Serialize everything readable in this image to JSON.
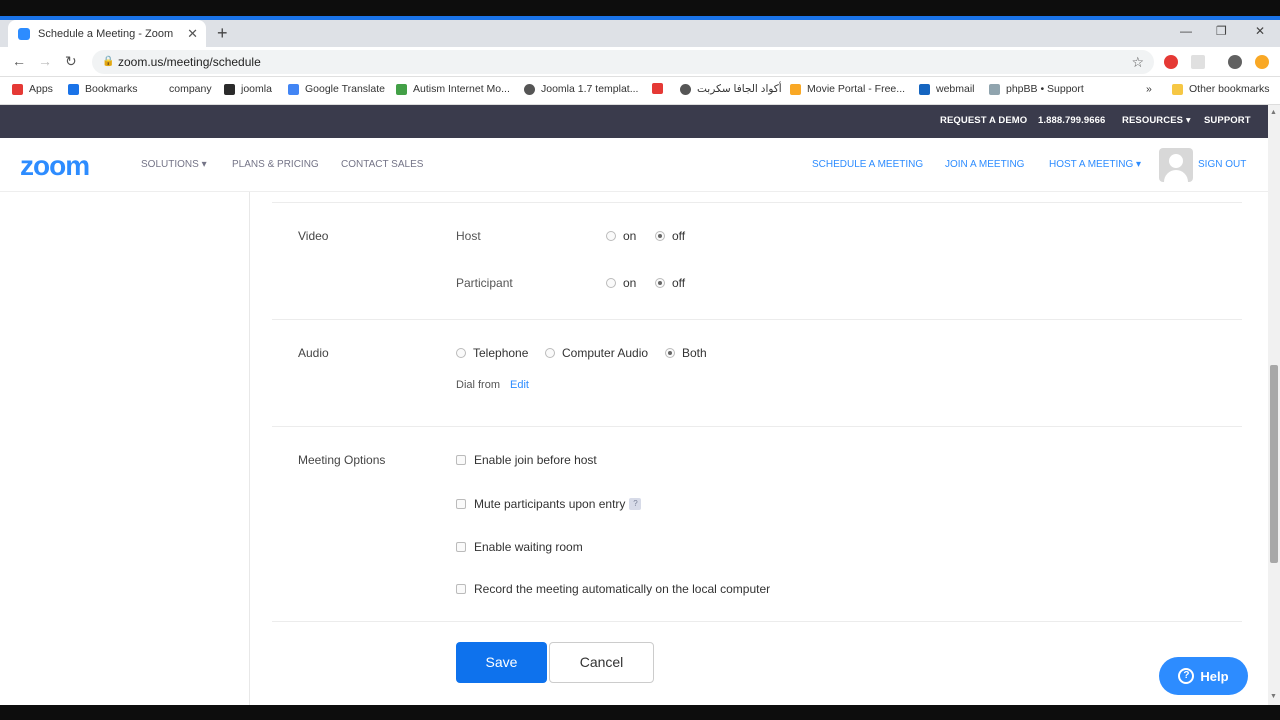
{
  "browser": {
    "tab_title": "Schedule a Meeting - Zoom",
    "tab_close": "✕",
    "new_tab": "+",
    "url": "zoom.us/meeting/schedule",
    "controls": {
      "minimize": "—",
      "restore": "❐",
      "close": "✕"
    }
  },
  "bookmarks": [
    {
      "label": "Apps",
      "color": "#e53935"
    },
    {
      "label": "Bookmarks",
      "color": "#1a73e8"
    },
    {
      "label": "company",
      "color": "#ffffff"
    },
    {
      "label": "joomla",
      "color": "#2b2b2b"
    },
    {
      "label": "Google Translate",
      "color": "#4285f4"
    },
    {
      "label": "Autism Internet Mo...",
      "color": "#43a047"
    },
    {
      "label": "Joomla 1.7 templat...",
      "color": "#555555"
    },
    {
      "label": "أكواد الجافا سكربت",
      "color": "#555555"
    },
    {
      "label": "Movie Portal - Free...",
      "color": "#f9a825"
    },
    {
      "label": "webmail",
      "color": "#1565c0"
    },
    {
      "label": "phpBB • Support",
      "color": "#90a4ae"
    }
  ],
  "bookmarks_more": "»",
  "other_bookmarks": "Other bookmarks",
  "zoom_top": {
    "request_demo": "REQUEST A DEMO",
    "phone": "1.888.799.9666",
    "resources": "RESOURCES ▾",
    "support": "SUPPORT"
  },
  "zoom_nav": {
    "logo": "zoom",
    "solutions": "SOLUTIONS ▾",
    "plans": "PLANS & PRICING",
    "contact": "CONTACT SALES",
    "schedule": "SCHEDULE A MEETING",
    "join": "JOIN A MEETING",
    "host": "HOST A MEETING ▾",
    "signout": "SIGN OUT"
  },
  "video": {
    "label": "Video",
    "host_label": "Host",
    "participant_label": "Participant",
    "on": "on",
    "off": "off",
    "host_value": "off",
    "participant_value": "off"
  },
  "audio": {
    "label": "Audio",
    "options": [
      "Telephone",
      "Computer Audio",
      "Both"
    ],
    "selected": "Both",
    "dial_from": "Dial from",
    "edit": "Edit"
  },
  "meeting_options": {
    "label": "Meeting Options",
    "items": [
      {
        "label": "Enable join before host",
        "checked": false
      },
      {
        "label": "Mute participants upon entry",
        "checked": false
      },
      {
        "label": "Enable waiting room",
        "checked": false
      },
      {
        "label": "Record the meeting automatically on the local computer",
        "checked": false
      }
    ]
  },
  "buttons": {
    "save": "Save",
    "cancel": "Cancel",
    "help": "Help"
  },
  "colors": {
    "accent": "#2d8cff",
    "save_button": "#0e72ed",
    "topbar": "#3a3b4c"
  }
}
